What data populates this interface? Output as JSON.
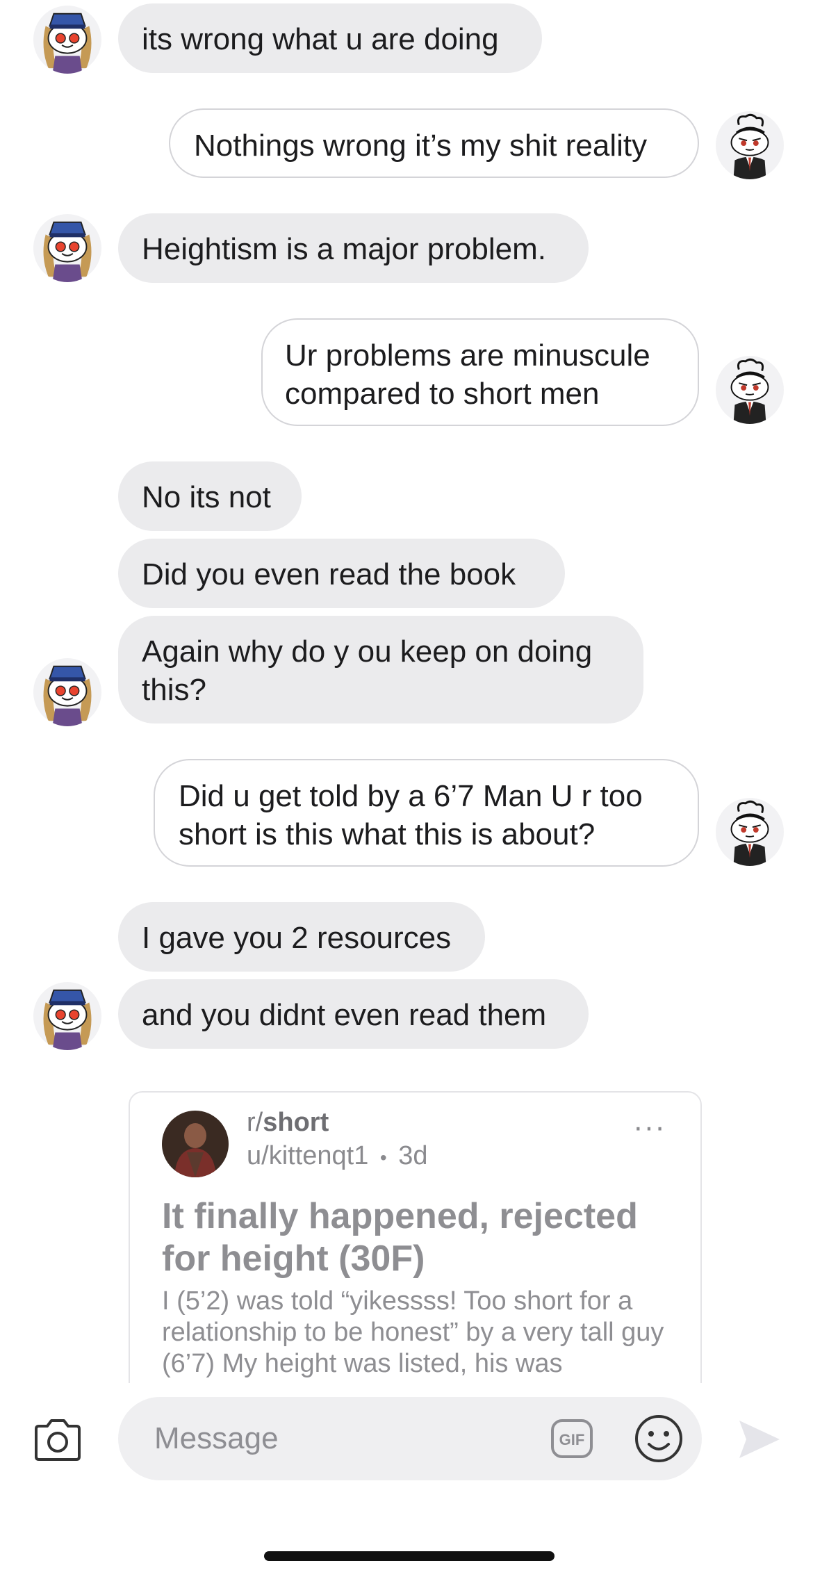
{
  "messages": [
    {
      "text": "its wrong what u are doing"
    },
    {
      "text": "Nothings wrong it’s my shit reality"
    },
    {
      "text": "Heightism is a major problem."
    },
    {
      "text": "Ur problems are minuscule compared to short men"
    },
    {
      "text": "No its not"
    },
    {
      "text": "Did you  even read the book"
    },
    {
      "text": "Again why do y ou keep on doing this?"
    },
    {
      "text": "Did u get told by a 6’7 Man U r too short is this what this is about?"
    },
    {
      "text": "I gave you 2 resources"
    },
    {
      "text": "and you didnt even read them"
    }
  ],
  "shared_post": {
    "subreddit_prefix": "r/",
    "subreddit": "short",
    "author": "u/kittenqt1",
    "separator": "•",
    "age": "3d",
    "more": "···",
    "title": "It finally happened, rejected for height (30F)",
    "body": "I (5’2) was told “yikessss! Too short for a relationship to be honest” by a very tall guy (6’7) My height was listed, his was"
  },
  "composer": {
    "placeholder": "Message",
    "gif_label": "GIF"
  },
  "colors": {
    "incoming_bubble": "#ebebed",
    "outgoing_border": "#d4d4d8",
    "icon_gray": "#8e8e93"
  }
}
